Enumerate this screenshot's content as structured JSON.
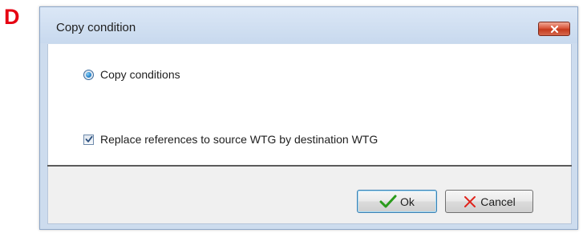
{
  "figure_label": "D",
  "window": {
    "title": "Copy condition",
    "close_icon": "close-icon"
  },
  "options": {
    "radio_label": "Copy conditions",
    "radio_selected": true,
    "checkbox_label": "Replace references to source WTG by destination WTG",
    "checkbox_checked": true
  },
  "buttons": {
    "ok_label": "Ok",
    "ok_icon": "checkmark-icon",
    "cancel_label": "Cancel",
    "cancel_icon": "cross-icon"
  },
  "colors": {
    "figure_label": "#e60012",
    "ok_icon": "#2a9b1c",
    "cancel_icon": "#e0241c",
    "close_button": "#c53a1c"
  }
}
